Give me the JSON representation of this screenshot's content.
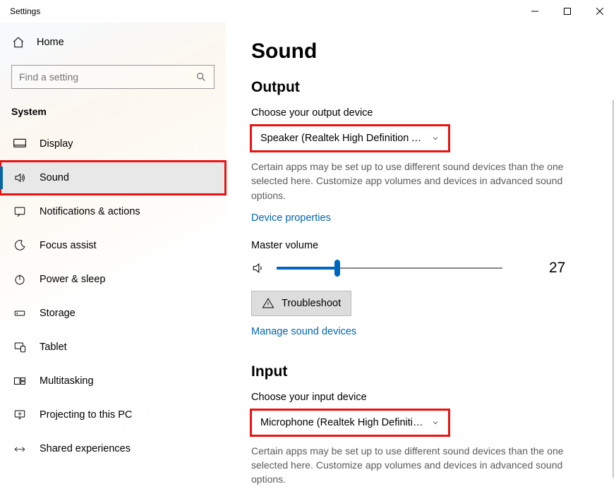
{
  "window": {
    "title": "Settings"
  },
  "sidebar": {
    "home_label": "Home",
    "search_placeholder": "Find a setting",
    "group_label": "System",
    "items": [
      {
        "label": "Display"
      },
      {
        "label": "Sound"
      },
      {
        "label": "Notifications & actions"
      },
      {
        "label": "Focus assist"
      },
      {
        "label": "Power & sleep"
      },
      {
        "label": "Storage"
      },
      {
        "label": "Tablet"
      },
      {
        "label": "Multitasking"
      },
      {
        "label": "Projecting to this PC"
      },
      {
        "label": "Shared experiences"
      }
    ]
  },
  "page": {
    "title": "Sound",
    "output": {
      "heading": "Output",
      "choose_label": "Choose your output device",
      "device": "Speaker (Realtek High Definition Au…",
      "help": "Certain apps may be set up to use different sound devices than the one selected here. Customize app volumes and devices in advanced sound options.",
      "device_properties": "Device properties",
      "volume_label": "Master volume",
      "volume_value": "27",
      "troubleshoot": "Troubleshoot",
      "manage": "Manage sound devices"
    },
    "input": {
      "heading": "Input",
      "choose_label": "Choose your input device",
      "device": "Microphone (Realtek High Definitio…",
      "help": "Certain apps may be set up to use different sound devices than the one selected here. Customize app volumes and devices in advanced sound options."
    }
  }
}
